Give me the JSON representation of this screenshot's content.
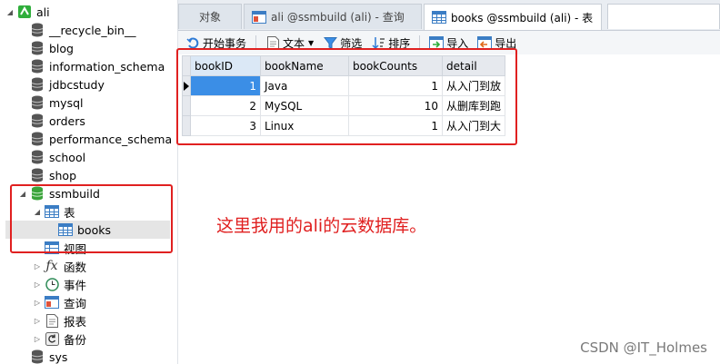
{
  "sidebar": {
    "connection": {
      "label": "ali",
      "icon": "connection-icon"
    },
    "databases": [
      {
        "label": "__recycle_bin__"
      },
      {
        "label": "blog"
      },
      {
        "label": "information_schema"
      },
      {
        "label": "jdbcstudy"
      },
      {
        "label": "mysql"
      },
      {
        "label": "orders"
      },
      {
        "label": "performance_schema"
      },
      {
        "label": "school"
      },
      {
        "label": "shop"
      },
      {
        "label": "ssmbuild"
      }
    ],
    "ssmbuild_children": {
      "tables": "表",
      "table_items": [
        "books"
      ],
      "views": "视图",
      "functions": "函数",
      "events": "事件",
      "queries": "查询",
      "reports": "报表",
      "backups": "备份"
    },
    "after": [
      {
        "label": "sys"
      }
    ]
  },
  "tabs": [
    {
      "label": "对象"
    },
    {
      "label": "ali @ssmbuild (ali) - 查询"
    },
    {
      "label": "books @ssmbuild (ali) - 表"
    }
  ],
  "toolbar": {
    "begin_transaction": "开始事务",
    "text": "文本",
    "filter": "筛选",
    "sort": "排序",
    "import": "导入",
    "export": "导出"
  },
  "table": {
    "columns": [
      "bookID",
      "bookName",
      "bookCounts",
      "detail"
    ],
    "rows": [
      [
        "1",
        "Java",
        "1",
        "从入门到放"
      ],
      [
        "2",
        "MySQL",
        "10",
        "从删库到跑"
      ],
      [
        "3",
        "Linux",
        "1",
        "从入门到大"
      ]
    ]
  },
  "annotation": "这里我用的ali的云数据库。",
  "watermark": "CSDN @IT_Holmes",
  "colors": {
    "highlight": "#e02020",
    "selection": "#3b8ee6",
    "db_icon": "#555555",
    "db_icon_active": "#3aa33a"
  }
}
